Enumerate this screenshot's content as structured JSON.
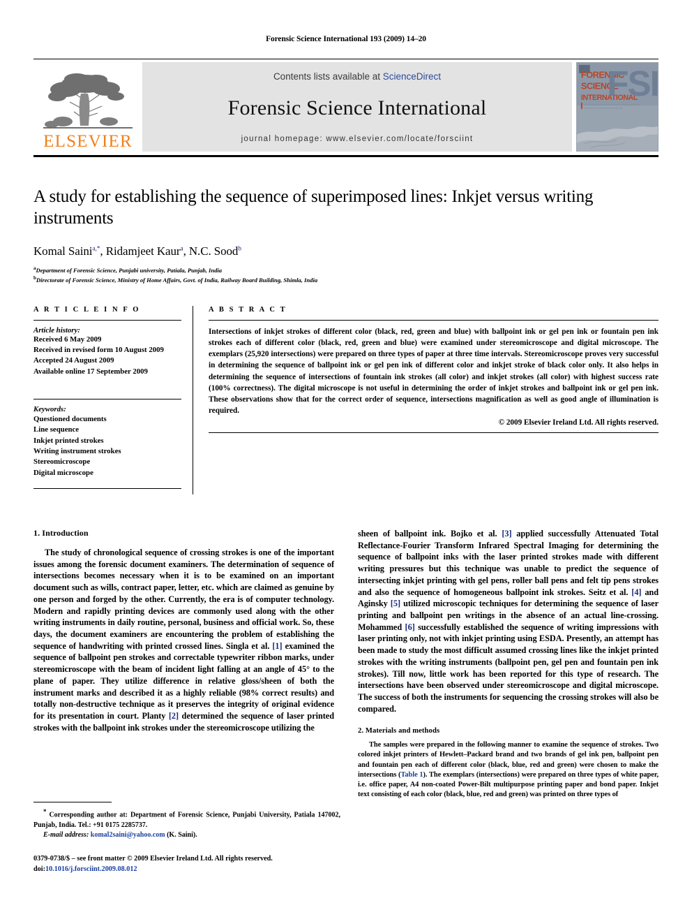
{
  "running_head": "Forensic Science International 193 (2009) 14–20",
  "banner": {
    "contents_prefix": "Contents lists available at ",
    "sciencedirect": "ScienceDirect",
    "journal_title": "Forensic Science International",
    "homepage": "journal homepage: www.elsevier.com/locate/forsciint",
    "publisher_wordmark": "ELSEVIER",
    "cover": {
      "line1": "FORENSIC",
      "line2": "SCIENCE",
      "line3": "INTERNATIONAL",
      "monogram": "FSI"
    },
    "colors": {
      "panel_bg": "#e3e3e3",
      "elsevier_orange": "#F07F1A",
      "link_blue": "#2b4a9b",
      "cover_bg": "#8e9aa8",
      "cover_red": "#c0392b",
      "cover_blue": "#6f7f98"
    }
  },
  "title": "A study for establishing the sequence of superimposed lines: Inkjet versus writing instruments",
  "authors": [
    {
      "name": "Komal Saini",
      "sup": "a,*"
    },
    {
      "name": "Ridamjeet Kaur",
      "sup": "a"
    },
    {
      "name": "N.C. Sood",
      "sup": "b"
    }
  ],
  "affiliations": [
    {
      "marker": "a",
      "text": "Department of Forensic Science, Punjabi university, Patiala, Punjab, India"
    },
    {
      "marker": "b",
      "text": "Directorate of Forensic Science, Ministry of Home Affairs, Govt. of India, Railway Board Building, Shimla, India"
    }
  ],
  "article_info": {
    "heading": "A R T I C L E  I N F O",
    "history_label": "Article history:",
    "history": [
      "Received 6 May 2009",
      "Received in revised form 10 August 2009",
      "Accepted 24 August 2009",
      "Available online 17 September 2009"
    ],
    "keywords_label": "Keywords:",
    "keywords": [
      "Questioned documents",
      "Line sequence",
      "Inkjet printed strokes",
      "Writing instrument strokes",
      "Stereomicroscope",
      "Digital microscope"
    ]
  },
  "abstract": {
    "heading": "A B S T R A C T",
    "text": "Intersections of inkjet strokes of different color (black, red, green and blue) with ballpoint ink or gel pen ink or fountain pen ink strokes each of different color (black, red, green and blue) were examined under stereomicroscope and digital microscope. The exemplars (25,920 intersections) were prepared on three types of paper at three time intervals. Stereomicroscope proves very successful in determining the sequence of ballpoint ink or gel pen ink of different color and inkjet stroke of black color only. It also helps in determining the sequence of intersections of fountain ink strokes (all color) and inkjet strokes (all color) with highest success rate (100% correctness). The digital microscope is not useful in determining the order of inkjet strokes and ballpoint ink or gel pen ink. These observations show that for the correct order of sequence, intersections magnification as well as good angle of illumination is required.",
    "copyright": "© 2009 Elsevier Ireland Ltd. All rights reserved."
  },
  "sections": {
    "introduction": {
      "heading": "1. Introduction",
      "para_left_part1": "The study of chronological sequence of crossing strokes is one of the important issues among the forensic document examiners. The determination of sequence of intersections becomes necessary when it is to be examined on an important document such as wills, contract paper, letter, etc. which are claimed as genuine by one person and forged by the other. Currently, the era is of computer technology. Modern and rapidly printing devices are commonly used along with the other writing instruments in daily routine, personal, business and official work. So, these days, the document examiners are encountering the problem of establishing the sequence of handwriting with printed crossed lines. Singla et al. ",
      "cite_1": "[1]",
      "para_left_part2": " examined the sequence of ballpoint pen strokes and correctable typewriter ribbon marks, under stereomicroscope with the beam of incident light falling at an angle of 45° to the plane of paper. They utilize difference in relative gloss/sheen of both the instrument marks and described it as a highly reliable (98% correct results) and totally non-destructive technique as it preserves the integrity of original evidence for its presentation in court. Planty ",
      "cite_2": "[2]",
      "para_left_part3": " determined the sequence of laser printed strokes with the ballpoint ink strokes under the stereomicroscope utilizing the",
      "para_right_part1": "sheen of ballpoint ink. Bojko et al. ",
      "cite_3": "[3]",
      "para_right_part2": " applied successfully Attenuated Total Reflectance-Fourier Transform Infrared Spectral Imaging for determining the sequence of ballpoint inks with the laser printed strokes made with different writing pressures but this technique was unable to predict the sequence of intersecting inkjet printing with gel pens, roller ball pens and felt tip pens strokes and also the sequence of homogeneous ballpoint ink strokes. Seitz et al. ",
      "cite_4": "[4]",
      "para_right_part3": " and Aginsky ",
      "cite_5": "[5]",
      "para_right_part4": " utilized microscopic techniques for determining the sequence of laser printing and ballpoint pen writings in the absence of an actual line-crossing. Mohammed ",
      "cite_6": "[6]",
      "para_right_part5": " successfully established the sequence of writing impressions with laser printing only, not with inkjet printing using ESDA. Presently, an attempt has been made to study the most difficult assumed crossing lines like the inkjet printed strokes with the writing instruments (ballpoint pen, gel pen and fountain pen ink strokes). Till now, little work has been reported for this type of research. The intersections have been observed under stereomicroscope and digital microscope. The success of both the instruments for sequencing the crossing strokes will also be compared."
    },
    "materials": {
      "heading": "2. Materials and methods",
      "para_part1": "The samples were prepared in the following manner to examine the sequence of strokes. Two colored inkjet printers of Hewlett–Packard brand and two brands of gel ink pen, ballpoint pen and fountain pen each of different color (black, blue, red and green) were chosen to make the intersections (",
      "table_link": "Table 1",
      "para_part2": "). The exemplars (intersections) were prepared on three types of white paper, i.e. office paper, A4 non-coated Power-Bilt multipurpose printing paper and bond paper. Inkjet text consisting of each color (black, blue, red and green) was printed on three types of"
    }
  },
  "footnote": {
    "marker": "*",
    "corresponding": " Corresponding author at: Department of Forensic Science, Punjabi University, Patiala 147002, Punjab, India. Tel.: +91 0175 2285737.",
    "email_label": "E-mail address:",
    "email": "komal2saini@yahoo.com",
    "email_suffix": " (K. Saini).",
    "issn_line": "0379-0738/$ – see front matter © 2009 Elsevier Ireland Ltd. All rights reserved.",
    "doi_label": "doi:",
    "doi_value": "10.1016/j.forsciint.2009.08.012"
  }
}
